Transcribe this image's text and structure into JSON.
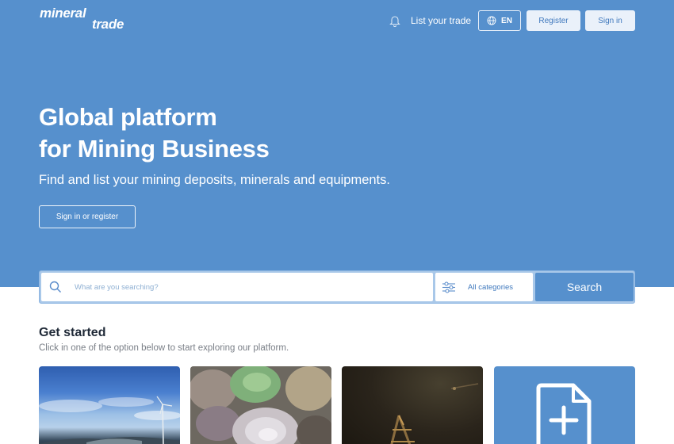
{
  "header": {
    "logo_line1": "mineral",
    "logo_line2": "trade",
    "list_trade_label": "List your trade",
    "language_label": "EN",
    "register_label": "Register",
    "signin_label": "Sign in",
    "icons": [
      "bell-icon",
      "globe-icon"
    ]
  },
  "hero": {
    "title_line1": "Global platform",
    "title_line2": "for Mining Business",
    "subtitle": "Find and list your mining deposits, minerals and equipments.",
    "cta_label": "Sign in or register",
    "background_color": "#5690cd"
  },
  "search": {
    "placeholder": "What are you searching?",
    "category_label": "All categories",
    "button_label": "Search",
    "icons": [
      "search-icon",
      "filter-icon"
    ]
  },
  "get_started": {
    "title": "Get started",
    "subtitle": "Click in one of the option below to start exploring our platform.",
    "cards": [
      {
        "name": "deposits-card",
        "image": "wind-turbine-landscape"
      },
      {
        "name": "minerals-card",
        "image": "mineral-rocks"
      },
      {
        "name": "equipments-card",
        "image": "mining-excavator-night"
      },
      {
        "name": "list-trade-card",
        "icon": "add-document-icon"
      }
    ]
  },
  "colors": {
    "brand": "#5690cd",
    "button_light": "#eaf1fa",
    "button_text": "#3f78bd",
    "heading": "#1f2937",
    "muted": "#7a7f87"
  }
}
